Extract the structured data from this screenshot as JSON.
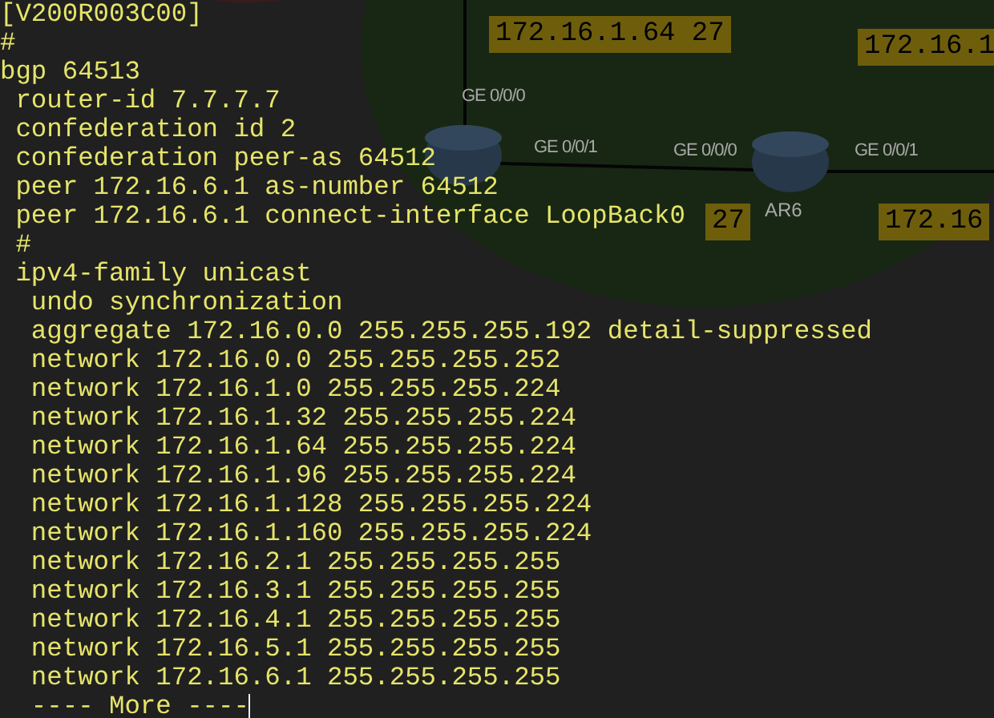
{
  "diagram": {
    "labels": [
      {
        "kind": "subnet",
        "text": "172.16.1.64 27"
      },
      {
        "kind": "subnet",
        "text": "172.16.1"
      },
      {
        "kind": "port",
        "text": "GE 0/0/0"
      },
      {
        "kind": "port",
        "text": "GE 0/0/1"
      },
      {
        "kind": "port",
        "text": "GE 0/0/0"
      },
      {
        "kind": "port",
        "text": "GE 0/0/1"
      },
      {
        "kind": "subnet",
        "text": "27"
      },
      {
        "kind": "device",
        "text": "AR6"
      },
      {
        "kind": "subnet",
        "text": "172.16"
      }
    ]
  },
  "terminal": {
    "lines": [
      "[V200R003C00]",
      "#",
      "bgp 64513",
      " router-id 7.7.7.7",
      " confederation id 2",
      " confederation peer-as 64512",
      " peer 172.16.6.1 as-number 64512",
      " peer 172.16.6.1 connect-interface LoopBack0",
      " #",
      " ipv4-family unicast",
      "  undo synchronization",
      "  aggregate 172.16.0.0 255.255.255.192 detail-suppressed",
      "  network 172.16.0.0 255.255.255.252",
      "  network 172.16.1.0 255.255.255.224",
      "  network 172.16.1.32 255.255.255.224",
      "  network 172.16.1.64 255.255.255.224",
      "  network 172.16.1.96 255.255.255.224",
      "  network 172.16.1.128 255.255.255.224",
      "  network 172.16.1.160 255.255.255.224",
      "  network 172.16.2.1 255.255.255.255",
      "  network 172.16.3.1 255.255.255.255",
      "  network 172.16.4.1 255.255.255.255",
      "  network 172.16.5.1 255.255.255.255",
      "  network 172.16.6.1 255.255.255.255",
      "  ---- More ----"
    ]
  }
}
